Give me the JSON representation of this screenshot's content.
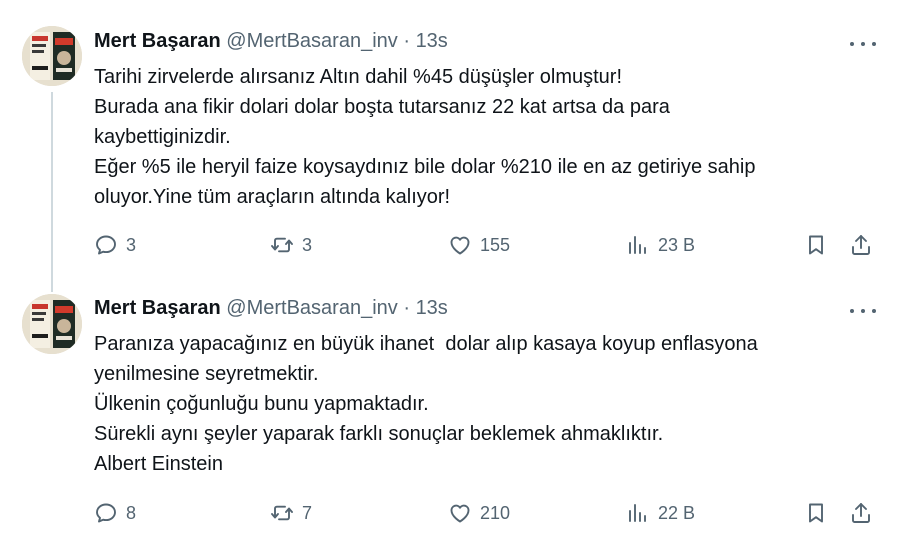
{
  "tweets": [
    {
      "author": {
        "name": "Mert Başaran",
        "handle": "@MertBasaran_inv",
        "separator": "·",
        "time": "13s"
      },
      "lines": [
        "Tarihi zirvelerde alırsanız Altın dahil %45 düşüşler olmuştur!",
        "Burada ana fikir dolari dolar boşta tutarsanız 22 kat artsa da para",
        "kaybettiginizdir.",
        "Eğer %5 ile heryil faize koysaydınız bile dolar %210 ile en az getiriye sahip",
        "oluyor.Yine tüm araçların altında kalıyor!"
      ],
      "stats": {
        "replies": "3",
        "retweets": "3",
        "likes": "155",
        "views": "23 B"
      }
    },
    {
      "author": {
        "name": "Mert Başaran",
        "handle": "@MertBasaran_inv",
        "separator": "·",
        "time": "13s"
      },
      "lines": [
        "Paranıza yapacağınız en büyük ihanet  dolar alıp kasaya koyup enflasyona",
        "yenilmesine seyretmektir.",
        "Ülkenin çoğunluğu bunu yapmaktadır.",
        "Sürekli aynı şeyler yaparak farklı sonuçlar beklemek ahmaklıktır.",
        "Albert Einstein"
      ],
      "stats": {
        "replies": "8",
        "retweets": "7",
        "likes": "210",
        "views": "22 B"
      }
    }
  ],
  "icons": [
    "reply-icon",
    "retweet-icon",
    "like-icon",
    "views-icon",
    "bookmark-icon",
    "share-icon",
    "more-icon"
  ],
  "colors": {
    "text": "#0f1419",
    "secondary": "#536471",
    "thread_line": "#cfd9de",
    "background": "#ffffff"
  }
}
